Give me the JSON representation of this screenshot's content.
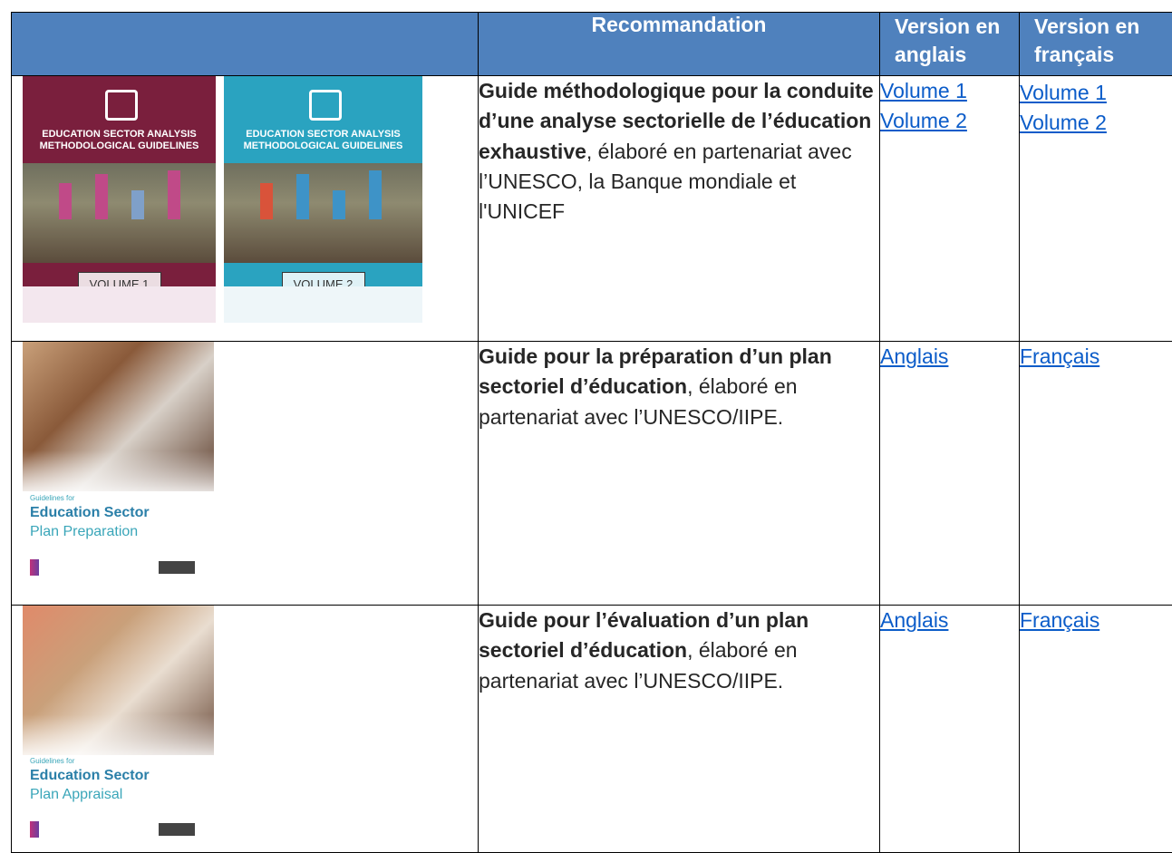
{
  "header": {
    "col_recommendation": "Recommandation",
    "col_english": "Version en anglais",
    "col_french": "Version en français"
  },
  "rows": [
    {
      "title_bold": "Guide méthodologique pour la conduite d’une analyse sectorielle de l’éducation exhaustive",
      "title_rest": ", élaboré en partenariat avec l’UNESCO, la Banque mondiale et l'UNICEF",
      "english_links": [
        "Volume 1",
        "Volume 2"
      ],
      "french_links": [
        "Volume 1",
        "Volume 2"
      ],
      "covers": [
        {
          "title": "EDUCATION SECTOR ANALYSIS METHODOLOGICAL GUIDELINES",
          "volume": "VOLUME 1",
          "color": "#7a1f3d"
        },
        {
          "title": "EDUCATION SECTOR ANALYSIS METHODOLOGICAL GUIDELINES",
          "volume": "VOLUME 2",
          "color": "#2aa3c0"
        }
      ]
    },
    {
      "title_bold": "Guide pour la préparation d’un plan sectoriel d’éducation",
      "title_rest": ", élaboré en partenariat avec l’UNESCO/IIPE.",
      "english_link": "Anglais",
      "french_link": "Français",
      "cover": {
        "small": "Guidelines for",
        "big": "Education Sector",
        "sub": "Plan Preparation"
      }
    },
    {
      "title_bold": "Guide pour l’évaluation d’un plan sectoriel d’éducation",
      "title_rest": ", élaboré en partenariat avec l’UNESCO/IIPE.",
      "english_link": "Anglais",
      "french_link": "Français",
      "cover": {
        "small": "Guidelines for",
        "big": "Education Sector",
        "sub": "Plan Appraisal"
      }
    }
  ],
  "colors": {
    "header_bg": "#4f81bd",
    "link": "#0b5cc9",
    "teal_text": "#3aa6b9"
  }
}
